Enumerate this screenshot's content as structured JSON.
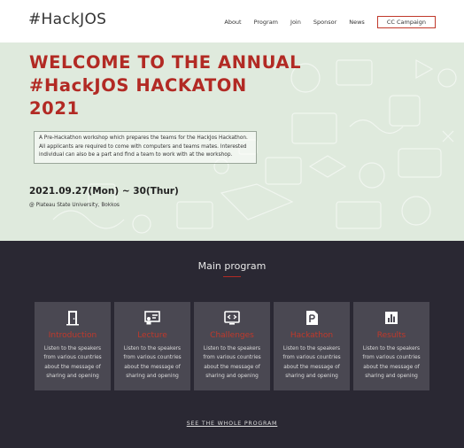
{
  "header": {
    "logo": "#HackJOS",
    "nav": [
      "About",
      "Program",
      "Join",
      "Sponsor",
      "News"
    ],
    "cta_label": "CC Campaign"
  },
  "hero": {
    "title_lines": [
      "WELCOME TO THE ANNUAL",
      "#HackJOS HACKATON",
      "2021"
    ],
    "description": "A Pre-Hackathon workshop which prepares the teams for the HackJos Hackathon. All applicants are required to come with computers and teams mates. Interested individual can also be a part and find a team to work with at the workshop.",
    "date": "2021.09.27(Mon) ~ 30(Thur)",
    "location": "@ Plateau State University, Bokkos"
  },
  "program": {
    "title": "Main program",
    "cards": [
      {
        "icon": "door-icon",
        "title": "Introduction",
        "text": "Listen to the speakers from various countries about the message of sharing and opening"
      },
      {
        "icon": "presentation-icon",
        "title": "Lecture",
        "text": "Listen to the speakers from various countries about the message of sharing and opening"
      },
      {
        "icon": "code-window-icon",
        "title": "Challenges",
        "text": "Listen to the speakers from various countries about the message of sharing and opening"
      },
      {
        "icon": "document-p-icon",
        "title": "Hackathon",
        "text": "Listen to the speakers from various countries about the message of sharing and opening"
      },
      {
        "icon": "bar-chart-icon",
        "title": "Results",
        "text": "Listen to the speakers from various countries about the message of sharing and opening"
      }
    ],
    "see_all_label": "SEE THE WHOLE PROGRAM"
  },
  "colors": {
    "accent": "#b22a24",
    "hero_bg": "#dfeadd",
    "program_bg": "#2a2833",
    "card_bg": "#4a4852"
  }
}
